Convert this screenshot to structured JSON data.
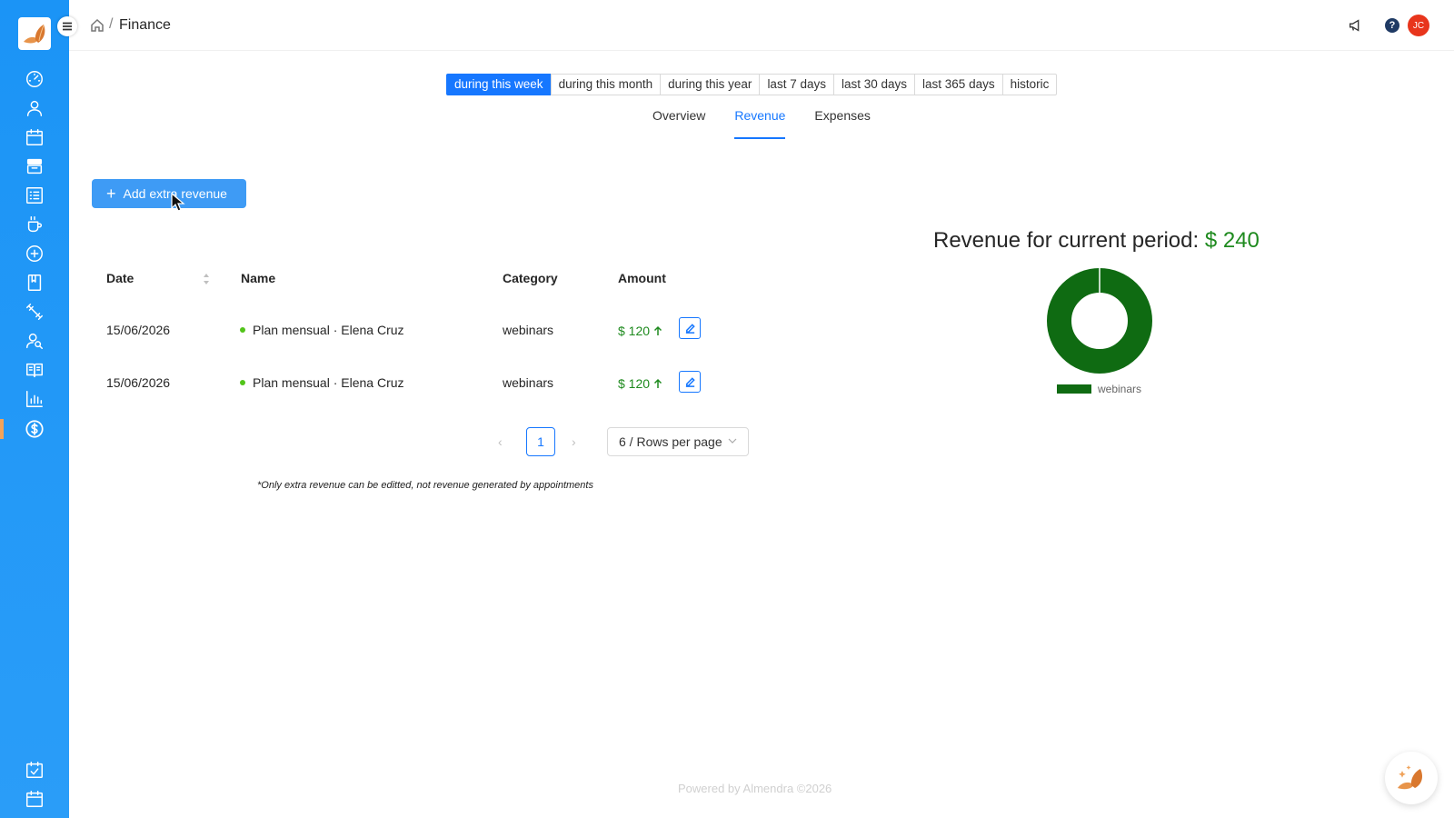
{
  "app": {
    "logo_icon": "almond-logo-icon",
    "accent_color": "#1677ff",
    "sidebar_color": "#1b94f6"
  },
  "header": {
    "breadcrumb_separator": "/",
    "title": "Finance",
    "avatar_initials": "JC",
    "help_label": "?"
  },
  "periods": [
    {
      "label": "during this week",
      "active": true
    },
    {
      "label": "during this month",
      "active": false
    },
    {
      "label": "during this year",
      "active": false
    },
    {
      "label": "last 7 days",
      "active": false
    },
    {
      "label": "last 30 days",
      "active": false
    },
    {
      "label": "last 365 days",
      "active": false
    },
    {
      "label": "historic",
      "active": false
    }
  ],
  "tabs": [
    {
      "label": "Overview",
      "active": false
    },
    {
      "label": "Revenue",
      "active": true
    },
    {
      "label": "Expenses",
      "active": false
    }
  ],
  "actions": {
    "add_label": "Add extra revenue"
  },
  "table": {
    "headers": {
      "date": "Date",
      "name": "Name",
      "category": "Category",
      "amount": "Amount"
    },
    "rows": [
      {
        "date": "15/06/2026",
        "name": "Plan mensual · Elena Cruz",
        "category": "webinars",
        "amount": "$ 120"
      },
      {
        "date": "15/06/2026",
        "name": "Plan mensual · Elena Cruz",
        "category": "webinars",
        "amount": "$ 120"
      }
    ]
  },
  "pagination": {
    "prev": "‹",
    "current_page": "1",
    "next": "›",
    "page_size": "6 / Rows per page"
  },
  "note": "*Only extra revenue can be editted, not revenue generated by appointments",
  "revenue": {
    "title": "Revenue for current period: ",
    "value": "$ 240"
  },
  "chart_data": {
    "type": "pie",
    "categories": [
      "webinars"
    ],
    "values": [
      240
    ],
    "colors": [
      "#0f6b12"
    ],
    "legend": "bottom"
  },
  "footer": "Powered by Almendra ©2026"
}
